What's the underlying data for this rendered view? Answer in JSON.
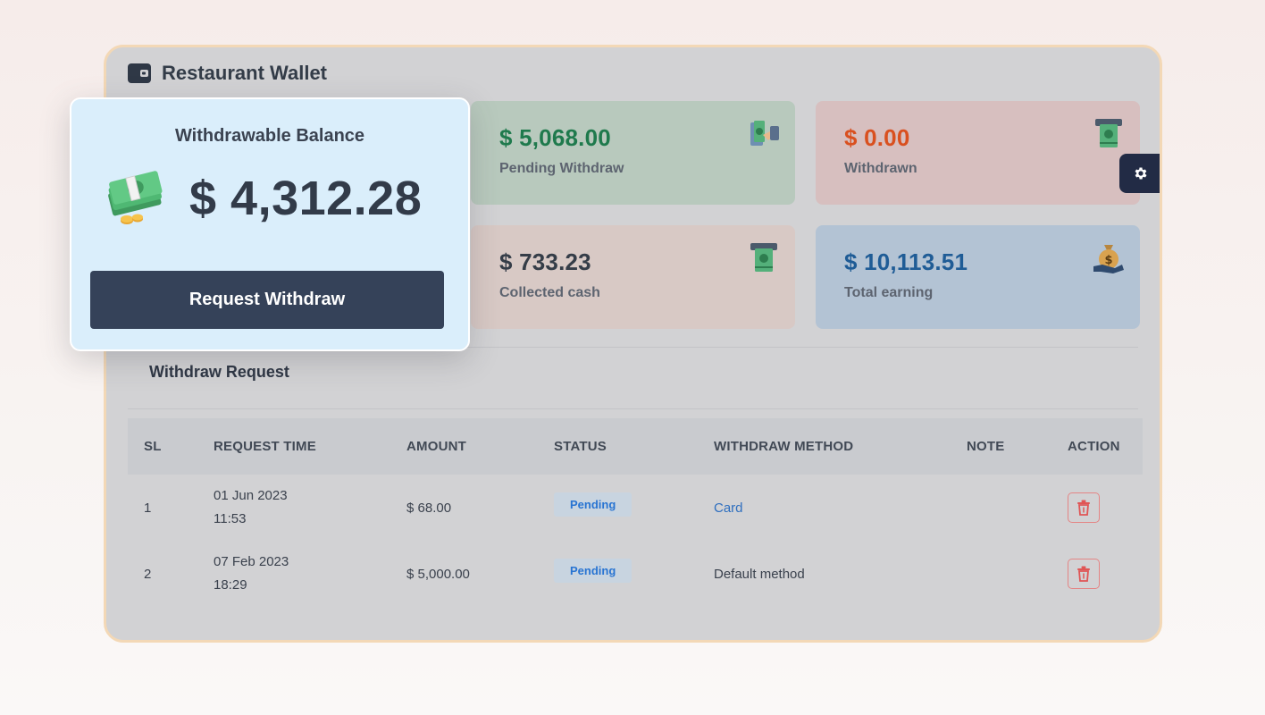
{
  "header": {
    "title": "Restaurant Wallet",
    "icon": "wallet-icon"
  },
  "balance": {
    "title": "Withdrawable Balance",
    "amount": "$ 4,312.28",
    "button_label": "Request Withdraw",
    "icon": "cash-stack-icon"
  },
  "stats": {
    "pending": {
      "amount": "$ 5,068.00",
      "label": "Pending Withdraw",
      "icon": "money-hand-icon",
      "color": "#1f7a4d"
    },
    "withdrawn": {
      "amount": "$ 0.00",
      "label": "Withdrawn",
      "icon": "atm-cash-icon",
      "color": "#d9501f"
    },
    "cash": {
      "amount": "$ 733.23",
      "label": "Collected cash",
      "icon": "atm-cash-icon",
      "color": "#353d48"
    },
    "earning": {
      "amount": "$ 10,113.51",
      "label": "Total earning",
      "icon": "money-bag-icon",
      "color": "#1f5c96"
    }
  },
  "withdraw_section": {
    "title": "Withdraw Request",
    "columns": [
      "SL",
      "REQUEST TIME",
      "AMOUNT",
      "STATUS",
      "WITHDRAW METHOD",
      "NOTE",
      "ACTION"
    ],
    "rows": [
      {
        "sl": "1",
        "date": "01 Jun 2023",
        "time": "11:53",
        "amount": "$ 68.00",
        "status": "Pending",
        "method": "Card",
        "note": ""
      },
      {
        "sl": "2",
        "date": "07 Feb 2023",
        "time": "18:29",
        "amount": "$ 5,000.00",
        "status": "Pending",
        "method": "Default method",
        "note": ""
      }
    ]
  },
  "settings": {
    "icon": "gear-icon"
  }
}
